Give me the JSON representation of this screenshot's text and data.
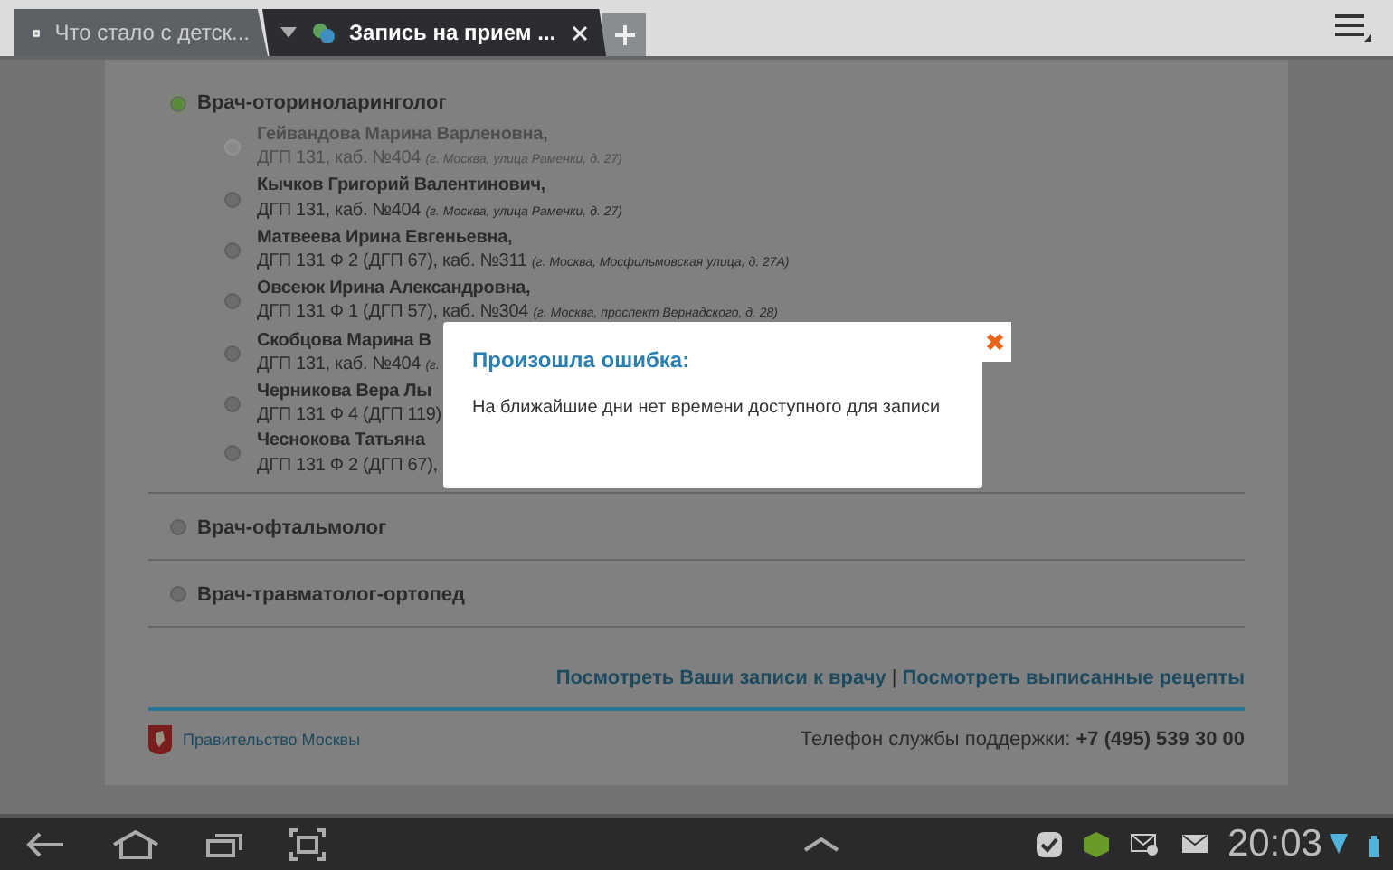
{
  "tabs": [
    {
      "title": "Что стало с детск...",
      "selected": false,
      "kind": "page"
    },
    {
      "title": "Запись на прием ...",
      "selected": true,
      "kind": "site"
    }
  ],
  "specialties": [
    {
      "name": "Врач-оториноларинголог",
      "selected": true,
      "doctors": [
        {
          "name": "Гейвандова Марина Варленовна,",
          "clinic": "ДГП 131, каб. №404",
          "location": "(г. Москва, улица Раменки, д. 27)",
          "disabled": true
        },
        {
          "name": "Кычков Григорий Валентинович,",
          "clinic": "ДГП 131, каб. №404",
          "location": "(г. Москва, улица Раменки, д. 27)",
          "disabled": false
        },
        {
          "name": "Матвеева Ирина Евгеньевна,",
          "clinic": "ДГП 131 Ф 2 (ДГП 67), каб. №311",
          "location": "(г. Москва, Мосфильмовская улица, д. 27А)",
          "disabled": false
        },
        {
          "name": "Овсеюк Ирина Александровна,",
          "clinic": "ДГП 131 Ф 1 (ДГП 57), каб. №304",
          "location": "(г. Москва, проспект Вернадского, д. 28)",
          "disabled": false
        },
        {
          "name": "Скобцова Марина В",
          "clinic": "ДГП 131, каб. №404",
          "location": "(г.",
          "disabled": false
        },
        {
          "name": "Черникова Вера Лы",
          "clinic": "ДГП 131 Ф 4 (ДГП 119)",
          "disabled": false
        },
        {
          "name": "Чеснокова Татьяна",
          "clinic": "ДГП 131 Ф 2 (ДГП 67),",
          "disabled": false
        }
      ]
    },
    {
      "name": "Врач-офтальмолог",
      "selected": false
    },
    {
      "name": "Врач-травматолог-ортопед",
      "selected": false
    }
  ],
  "links": [
    "Посмотреть Ваши записи к врачу",
    "Посмотреть выписанные рецепты"
  ],
  "link_separator": "|",
  "footer": {
    "organization": "Правительство Москвы",
    "support_label": "Телефон службы поддержки:",
    "support_phone": "+7 (495) 539 30 00"
  },
  "dialog": {
    "title": "Произошла ошибка:",
    "message": "На ближайшие дни нет времени доступного для записи"
  },
  "status_bar": {
    "time": "20:03"
  }
}
